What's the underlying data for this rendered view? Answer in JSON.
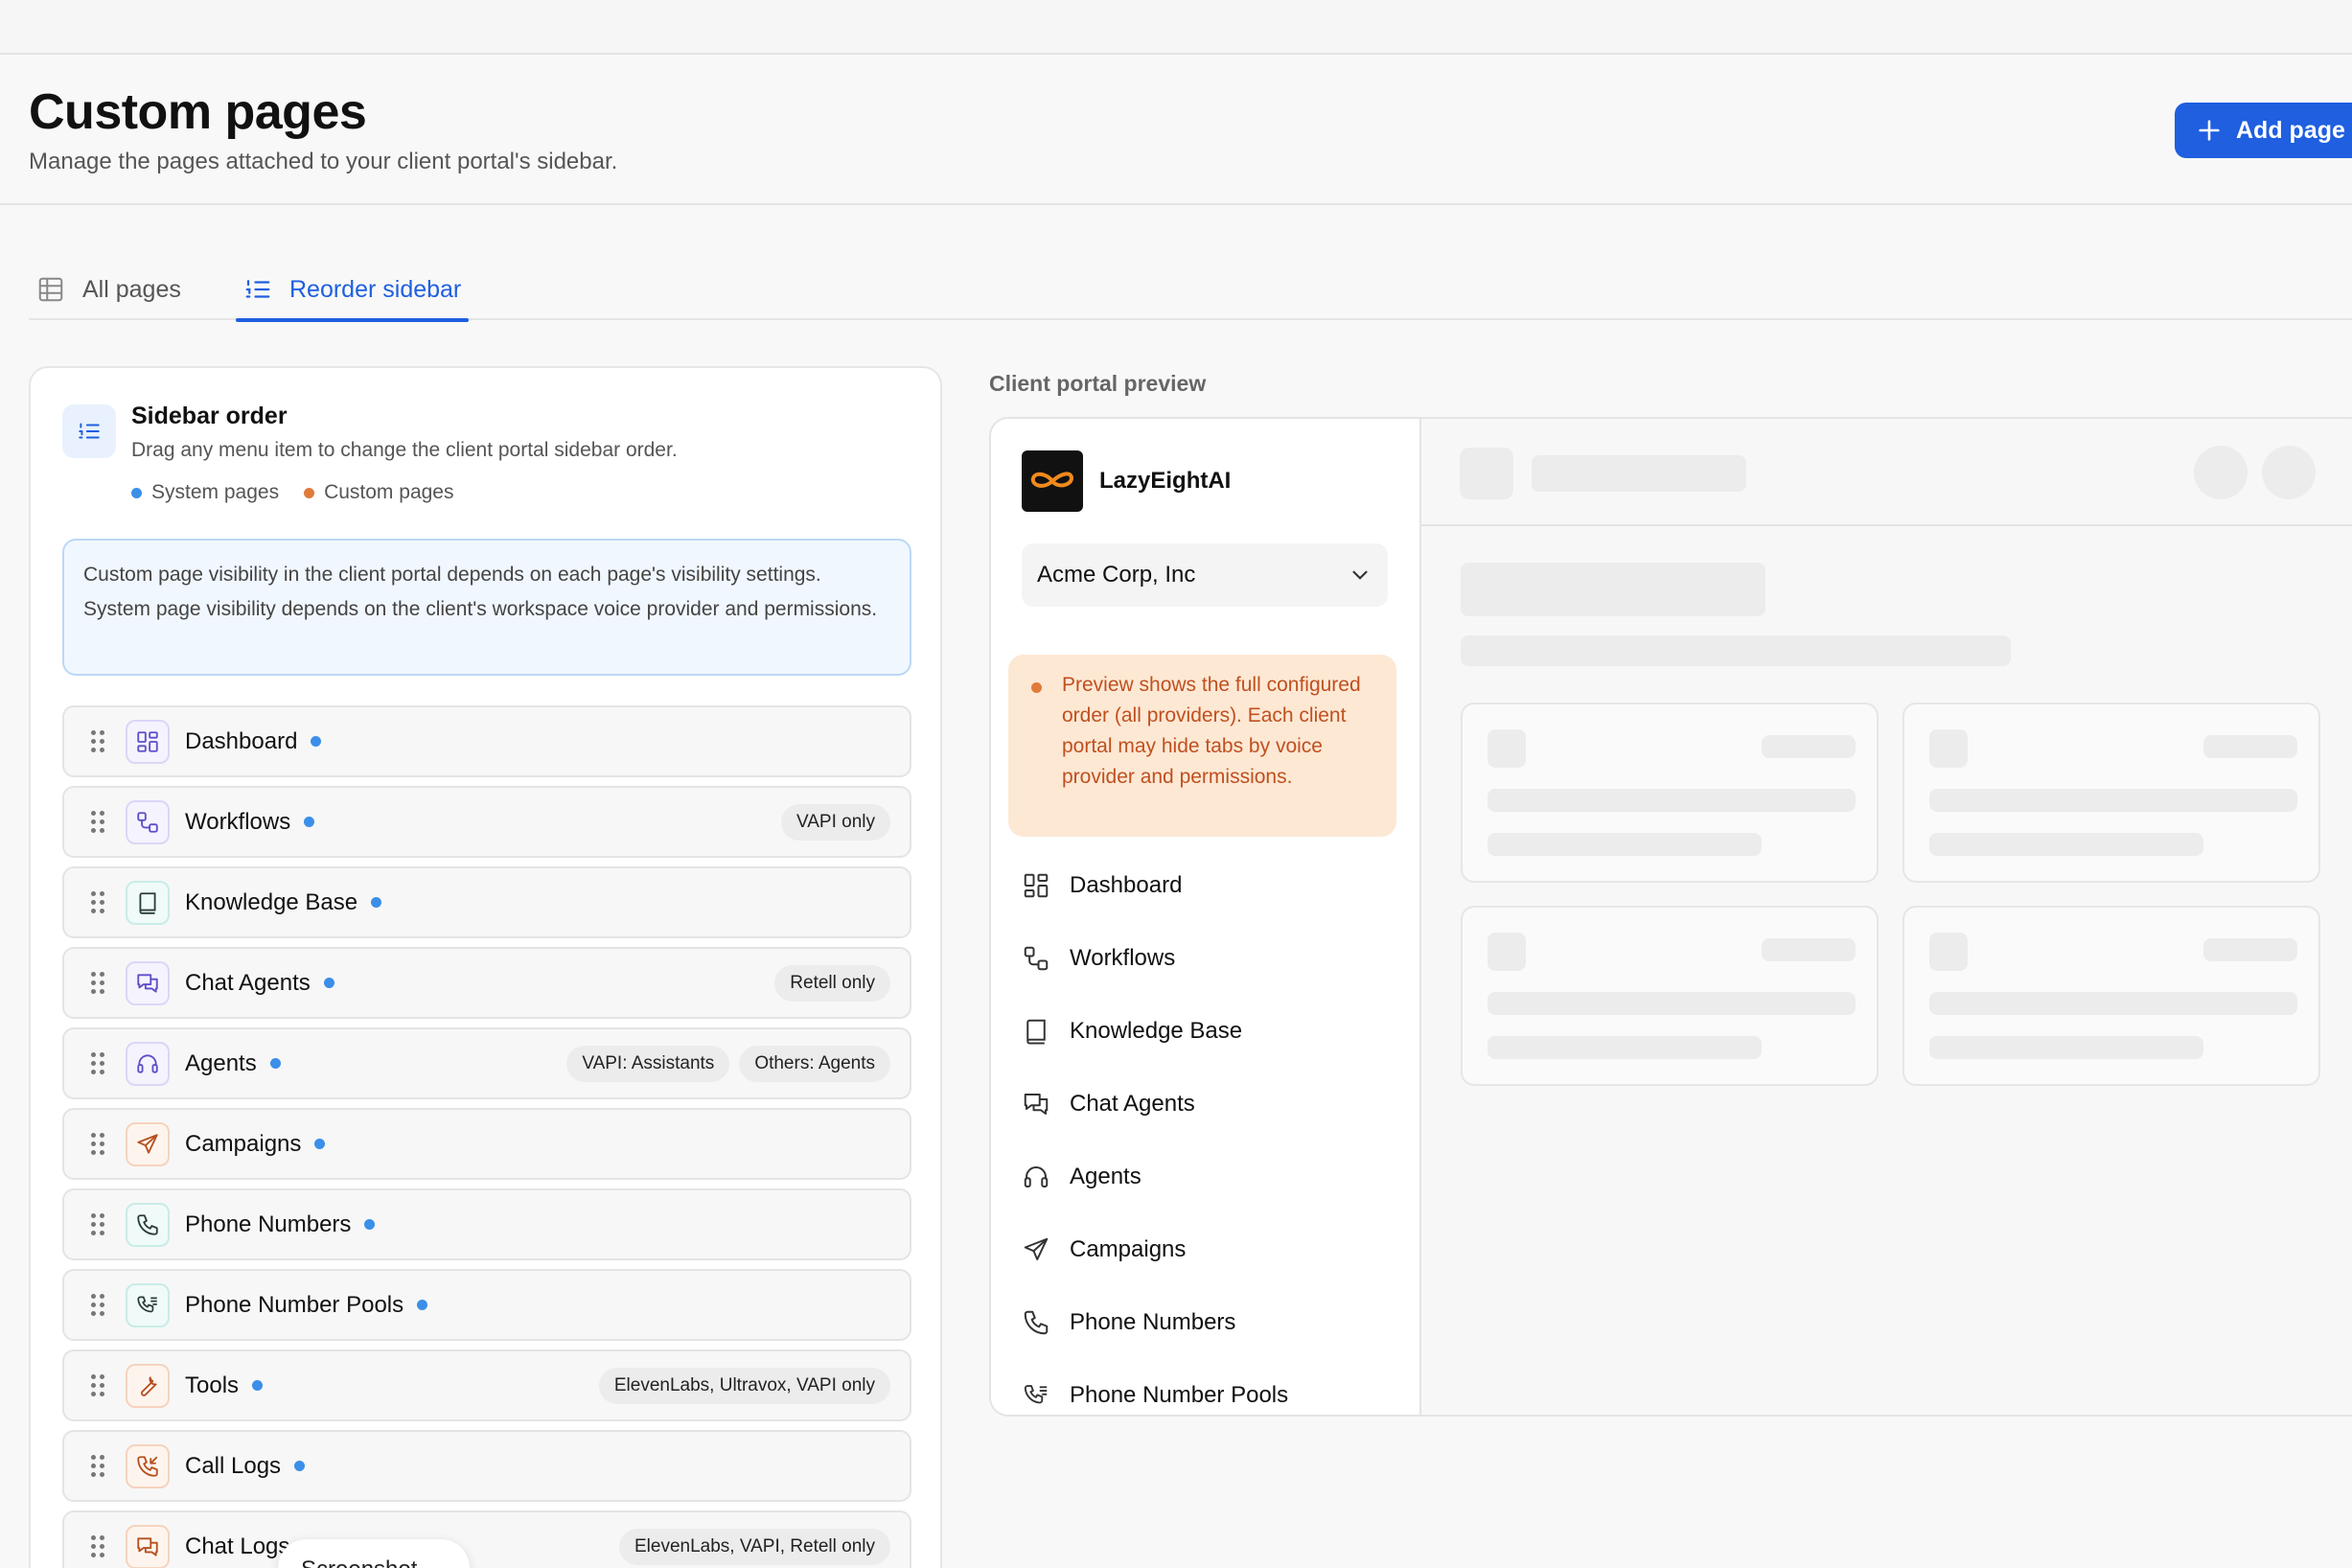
{
  "header": {
    "title": "Custom pages",
    "subtitle": "Manage the pages attached to your client portal's sidebar.",
    "add_button": "Add page"
  },
  "tabs": [
    {
      "label": "All pages",
      "icon": "table-icon"
    },
    {
      "label": "Reorder sidebar",
      "icon": "list-ordered-icon",
      "active": true
    }
  ],
  "sidebar_order": {
    "title": "Sidebar order",
    "description": "Drag any menu item to change the client portal sidebar order.",
    "legend_system": "System pages",
    "legend_custom": "Custom pages",
    "note": "Custom page visibility in the client portal depends on each page's visibility settings. System page visibility depends on the client's workspace voice provider and permissions.",
    "items": [
      {
        "label": "Dashboard",
        "icon": "dashboard-icon",
        "badges": []
      },
      {
        "label": "Workflows",
        "icon": "workflow-icon",
        "badges": [
          "VAPI only"
        ]
      },
      {
        "label": "Knowledge Base",
        "icon": "book-icon",
        "badges": []
      },
      {
        "label": "Chat Agents",
        "icon": "chat-icon",
        "badges": [
          "Retell only"
        ]
      },
      {
        "label": "Agents",
        "icon": "headset-icon",
        "badges": [
          "VAPI: Assistants",
          "Others: Agents"
        ]
      },
      {
        "label": "Campaigns",
        "icon": "send-icon",
        "badges": []
      },
      {
        "label": "Phone Numbers",
        "icon": "phone-icon",
        "badges": []
      },
      {
        "label": "Phone Number Pools",
        "icon": "phone-list-icon",
        "badges": []
      },
      {
        "label": "Tools",
        "icon": "wrench-icon",
        "badges": [
          "ElevenLabs, Ultravox, VAPI only"
        ]
      },
      {
        "label": "Call Logs",
        "icon": "phone-incoming-icon",
        "badges": []
      },
      {
        "label": "Chat Logs",
        "icon": "chat-log-icon",
        "badges": [
          "ElevenLabs, VAPI, Retell only"
        ]
      }
    ]
  },
  "preview": {
    "label": "Client portal preview",
    "brand": "LazyEightAI",
    "org": "Acme Corp, Inc",
    "warning": "Preview shows the full configured order (all providers). Each client portal may hide tabs by voice provider and permissions.",
    "nav": [
      "Dashboard",
      "Workflows",
      "Knowledge Base",
      "Chat Agents",
      "Agents",
      "Campaigns",
      "Phone Numbers",
      "Phone Number Pools"
    ]
  },
  "overlay": {
    "screenshot_label": "Screenshot"
  },
  "colors": {
    "accent": "#1f5fe0",
    "system_dot": "#3b8fe8",
    "custom_dot": "#e07b3a",
    "warning_text": "#c0501f"
  }
}
